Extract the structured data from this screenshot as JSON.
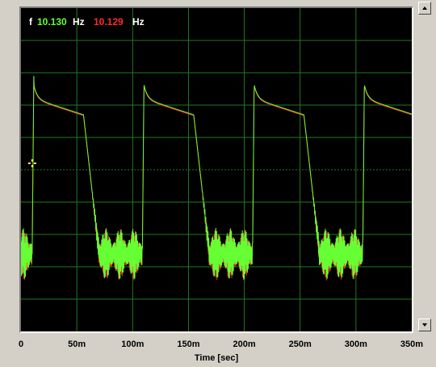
{
  "readouts": {
    "f_label": "f",
    "freq1": "10.130",
    "unit1": "Hz",
    "freq2": "10.129",
    "unit2": "Hz"
  },
  "colors": {
    "background": "#000000",
    "grid": "#1f7a1f",
    "trace1": "#66ff33",
    "trace2": "#ff2a2a",
    "freq1_text": "#66ff33",
    "freq2_text": "#ff2a2a",
    "label_text": "#ffffff",
    "cursor": "#ffe85a"
  },
  "chart_data": {
    "type": "line",
    "xlabel": "Time [sec]",
    "xlim": [
      0,
      0.35
    ],
    "x_ticks": [
      "0",
      "50m",
      "100m",
      "150m",
      "200m",
      "250m",
      "300m",
      "350m"
    ],
    "grid": true,
    "series": [
      {
        "color": "#66ff33"
      },
      {
        "color": "#ff2a2a"
      }
    ],
    "waveform": {
      "period_ms": 98.7,
      "pulse_starts_ms": [
        10,
        108.7,
        207.4,
        306.1
      ],
      "peak_level": 0.79,
      "plateau_start_level": 0.72,
      "plateau_end_level": 0.67,
      "mid_level": 0.5,
      "baseline_level": 0.24,
      "ripple_amplitude": 0.08
    },
    "cursor": {
      "x_ms": 10,
      "y_level": 0.5
    }
  },
  "scrollbar": {
    "visible": true
  }
}
